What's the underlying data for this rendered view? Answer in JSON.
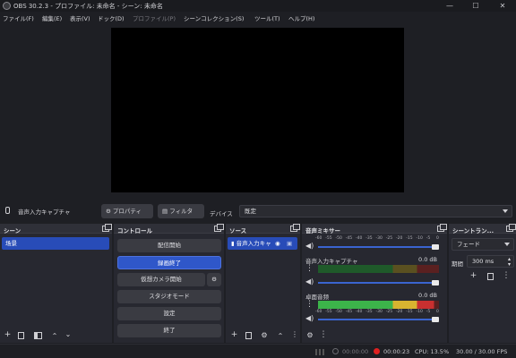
{
  "window": {
    "title": "OBS 30.2.3 - プロファイル: 未命名 - シーン: 未命名",
    "minimize": "—",
    "maximize": "☐",
    "close": "✕"
  },
  "menu": [
    {
      "label": "ファイル(F)",
      "disabled": false
    },
    {
      "label": "編集(E)",
      "disabled": false
    },
    {
      "label": "表示(V)",
      "disabled": false
    },
    {
      "label": "ドック(D)",
      "disabled": false
    },
    {
      "label": "プロファイル(P)",
      "disabled": true
    },
    {
      "label": "シーンコレクション(S)",
      "disabled": false
    },
    {
      "label": "ツール(T)",
      "disabled": false
    },
    {
      "label": "ヘルプ(H)",
      "disabled": false
    }
  ],
  "source_toolbar": {
    "selected_source": "音声入力キャプチャ",
    "properties": "プロパティ",
    "filters": "フィルタ",
    "device_label": "デバイス",
    "device_value": "既定"
  },
  "scenes": {
    "title": "シーン",
    "items": [
      "场景"
    ]
  },
  "controls": {
    "title": "コントロール",
    "buttons": [
      "配信開始",
      "録画終了",
      "仮想カメラ開始",
      "スタジオモード",
      "設定",
      "終了"
    ]
  },
  "sources": {
    "title": "ソース",
    "items": [
      "音声入力キャ"
    ]
  },
  "mixer": {
    "title": "音声ミキサー",
    "scale": [
      "-60",
      "-55",
      "-50",
      "-45",
      "-40",
      "-35",
      "-30",
      "-25",
      "-20",
      "-15",
      "-10",
      "-5",
      "0"
    ],
    "channels": [
      {
        "name": "音声入力キャプチャ",
        "db": "0.0 dB",
        "level": 0.0
      },
      {
        "name": "卓面音频",
        "db": "0.0 dB",
        "level": 0.96
      }
    ]
  },
  "transitions": {
    "title": "シーントラン...",
    "type": "フェード",
    "duration_label": "期間",
    "duration_value": "300 ms"
  },
  "status": {
    "stream_time": "00:00:00",
    "rec_time": "00:00:23",
    "cpu": "CPU: 13.5%",
    "fps": "30.00 / 30.00 FPS"
  },
  "colors": {
    "accent": "#2f57c9",
    "record": "#e02020",
    "meter_green": "#3cb44a",
    "meter_yellow": "#d8b430",
    "meter_red": "#c83030"
  }
}
